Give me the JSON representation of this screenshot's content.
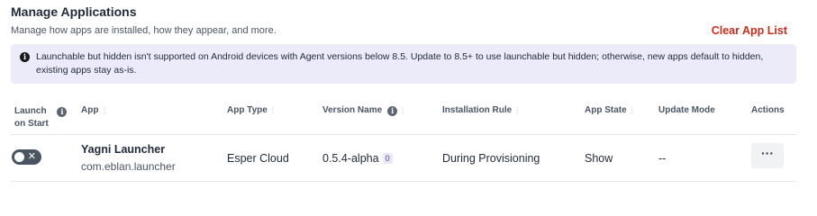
{
  "header": {
    "title": "Manage Applications",
    "subtitle": "Manage how apps are installed, how they appear, and more.",
    "clear_link": "Clear App List"
  },
  "banner": {
    "icon": "info-icon",
    "icon_glyph": "i",
    "text": "Launchable but hidden isn't supported on Android devices with Agent versions below 8.5. Update to 8.5+ to use launchable but hidden; otherwise, new apps default to hidden, existing apps stay as-is."
  },
  "table": {
    "headers": {
      "launch_line1": "Launch",
      "launch_line2": "on Start",
      "app": "App",
      "app_type": "App Type",
      "version_name": "Version Name",
      "installation_rule": "Installation Rule",
      "app_state": "App State",
      "update_mode": "Update Mode",
      "actions": "Actions"
    },
    "sort_glyph": "⋮",
    "info_glyph": "i",
    "rows": [
      {
        "launch_on_start": false,
        "toggle_glyph": "✕",
        "app_name": "Yagni Launcher",
        "package": "com.eblan.launcher",
        "app_type": "Esper Cloud",
        "version": "0.5.4-alpha",
        "version_badge": "0",
        "installation_rule": "During Provisioning",
        "app_state": "Show",
        "update_mode": "--",
        "actions_glyph": "···"
      }
    ]
  }
}
